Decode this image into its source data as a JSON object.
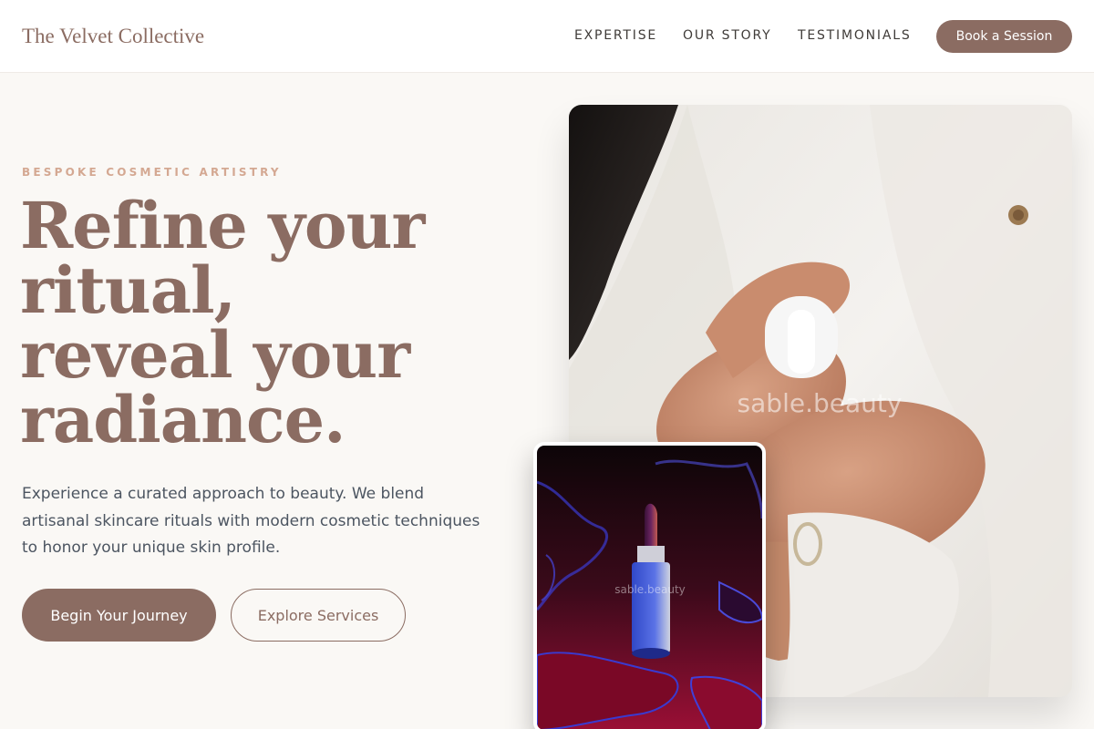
{
  "brand": {
    "name": "The Velvet Collective"
  },
  "nav": {
    "links": [
      {
        "label": "EXPERTISE"
      },
      {
        "label": "OUR STORY"
      },
      {
        "label": "TESTIMONIALS"
      }
    ],
    "cta_label": "Book a Session"
  },
  "hero": {
    "eyebrow": "BESPOKE COSMETIC ARTISTRY",
    "headline_lines": [
      "Refine your",
      "ritual,",
      "reveal your",
      "radiance."
    ],
    "lede": "Experience a curated approach to beauty. We blend artisanal skincare rituals with modern cosmetic techniques to honor your unique skin profile.",
    "primary_cta": "Begin Your Journey",
    "secondary_cta": "Explore Services"
  },
  "images": {
    "main_watermark": "sable.beauty",
    "secondary_watermark": "sable.beauty"
  },
  "colors": {
    "accent": "#8b6c62",
    "eyebrow": "#d4a892",
    "background": "#faf8f5",
    "body_text": "#4c5561"
  }
}
